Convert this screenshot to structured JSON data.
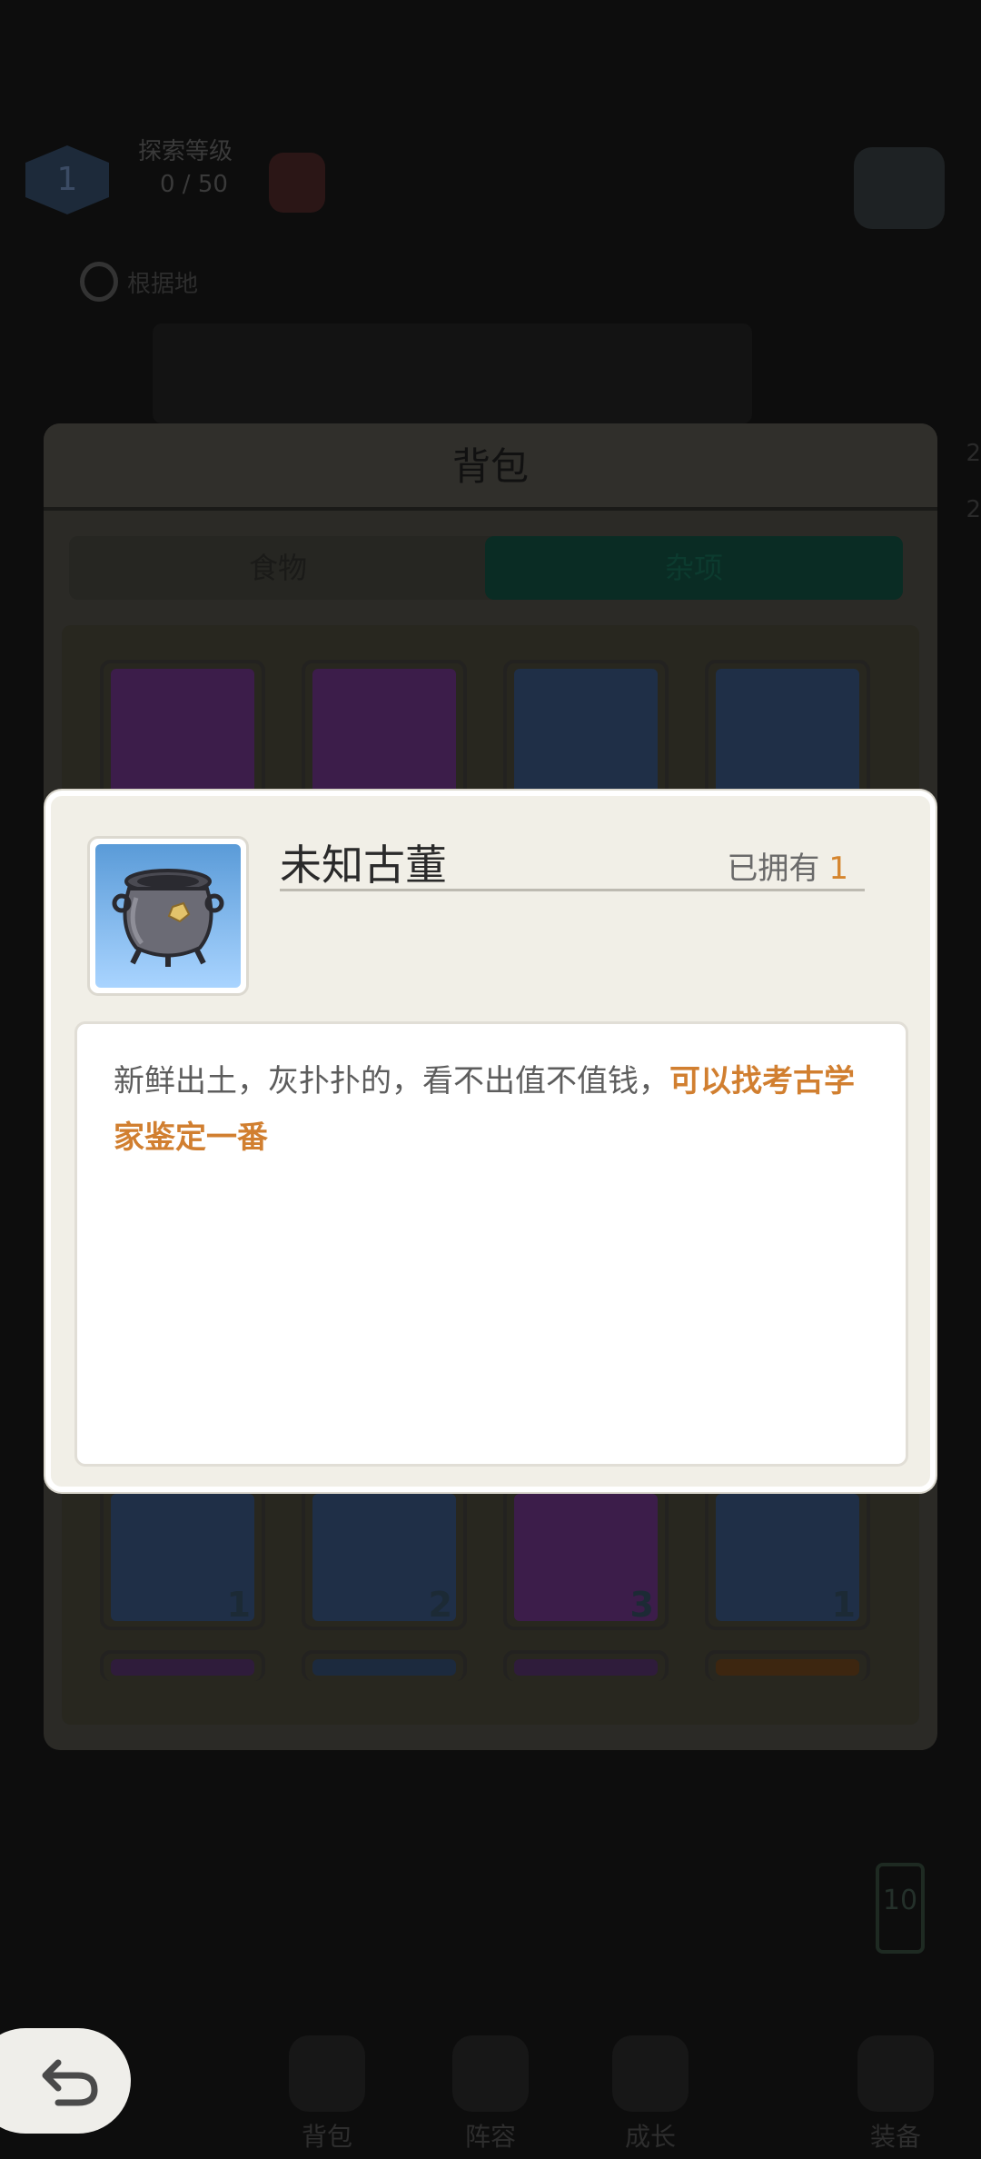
{
  "hud": {
    "level_badge": "1",
    "level_title": "探索等级",
    "level_value": "0 / 50",
    "location_label": "根据地",
    "side_labels": [
      "2",
      "2"
    ],
    "battery_value": "10"
  },
  "bottom_nav": [
    {
      "label": "背包",
      "icon": "backpack-icon"
    },
    {
      "label": "阵容",
      "icon": "team-icon"
    },
    {
      "label": "成长",
      "icon": "growth-icon"
    },
    {
      "label": "装备",
      "icon": "equipment-icon"
    }
  ],
  "bag": {
    "title": "背包",
    "tabs": [
      {
        "label": "食物",
        "active": false
      },
      {
        "label": "杂项",
        "active": true
      }
    ],
    "items_row_top": [
      {
        "name": "golden-leaf",
        "count": "",
        "color": "#3c1d4a"
      },
      {
        "name": "free-ticket",
        "count": "",
        "color": "#3c1d4a"
      },
      {
        "name": "golden-orb",
        "count": "",
        "color": "#1f2f47"
      },
      {
        "name": "rainbow-scroll",
        "count": "",
        "color": "#1f2f47"
      }
    ],
    "items_row_bottom": [
      {
        "name": "log",
        "count": "1",
        "color": "#1f2f47"
      },
      {
        "name": "banana",
        "count": "2",
        "color": "#1f2f47"
      },
      {
        "name": "stone",
        "count": "3",
        "color": "#3c1d4a"
      },
      {
        "name": "antique-pot",
        "count": "1",
        "color": "#1f2f47"
      }
    ]
  },
  "popup": {
    "item_name": "未知古董",
    "owned_label": "已拥有",
    "owned_count": "1",
    "description_plain": "新鲜出土，灰扑扑的，看不出值不值钱，",
    "description_highlight": "可以找考古学家鉴定一番",
    "highlight_color": "#d17f30"
  },
  "back_button": {
    "icon": "back-arrow-icon"
  }
}
